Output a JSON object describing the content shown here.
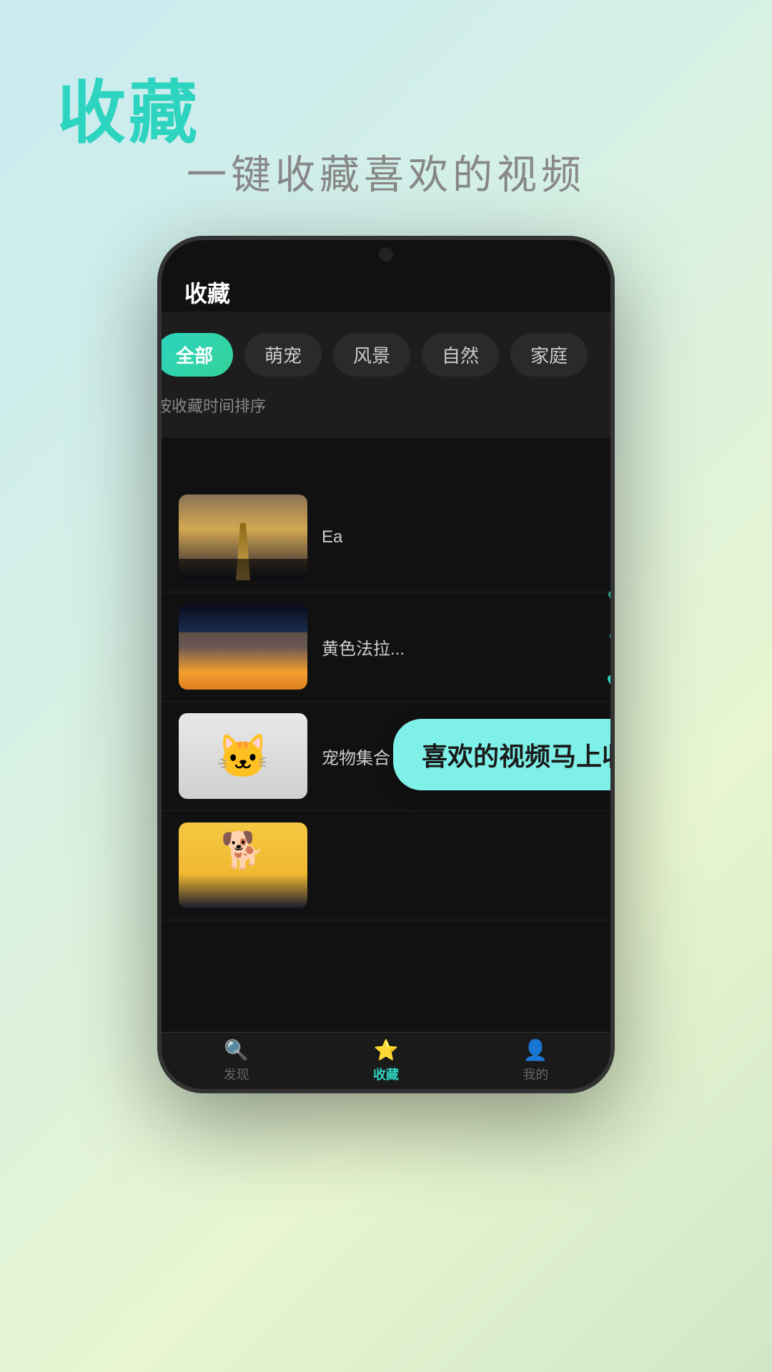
{
  "page": {
    "title": "收藏",
    "subtitle": "一键收藏喜欢的视频",
    "background": {
      "gradient_start": "#c8eaf0",
      "gradient_end": "#d0e8c8"
    }
  },
  "phone": {
    "screen_title": "收藏",
    "filter_tabs": [
      {
        "label": "全部",
        "active": true
      },
      {
        "label": "萌宠",
        "active": false
      },
      {
        "label": "风景",
        "active": false
      },
      {
        "label": "自然",
        "active": false
      },
      {
        "label": "家庭",
        "active": false
      }
    ],
    "sort_label": "按收藏时间排序",
    "video_items": [
      {
        "title": "Ea",
        "thumb_type": "eiffel"
      },
      {
        "title": "黄色法拉...",
        "thumb_type": "city"
      },
      {
        "title": "宠物集合",
        "thumb_type": "cat"
      },
      {
        "title": "",
        "thumb_type": "dog"
      }
    ],
    "bottom_nav": [
      {
        "label": "发现",
        "icon": "🔍",
        "active": false
      },
      {
        "label": "收藏",
        "icon": "⭐",
        "active": true
      },
      {
        "label": "我的",
        "icon": "👤",
        "active": false
      }
    ]
  },
  "floating": {
    "hearts": [
      "♥",
      "♥",
      "♥",
      "♥"
    ],
    "tooltip": "喜欢的视频马上收藏"
  }
}
